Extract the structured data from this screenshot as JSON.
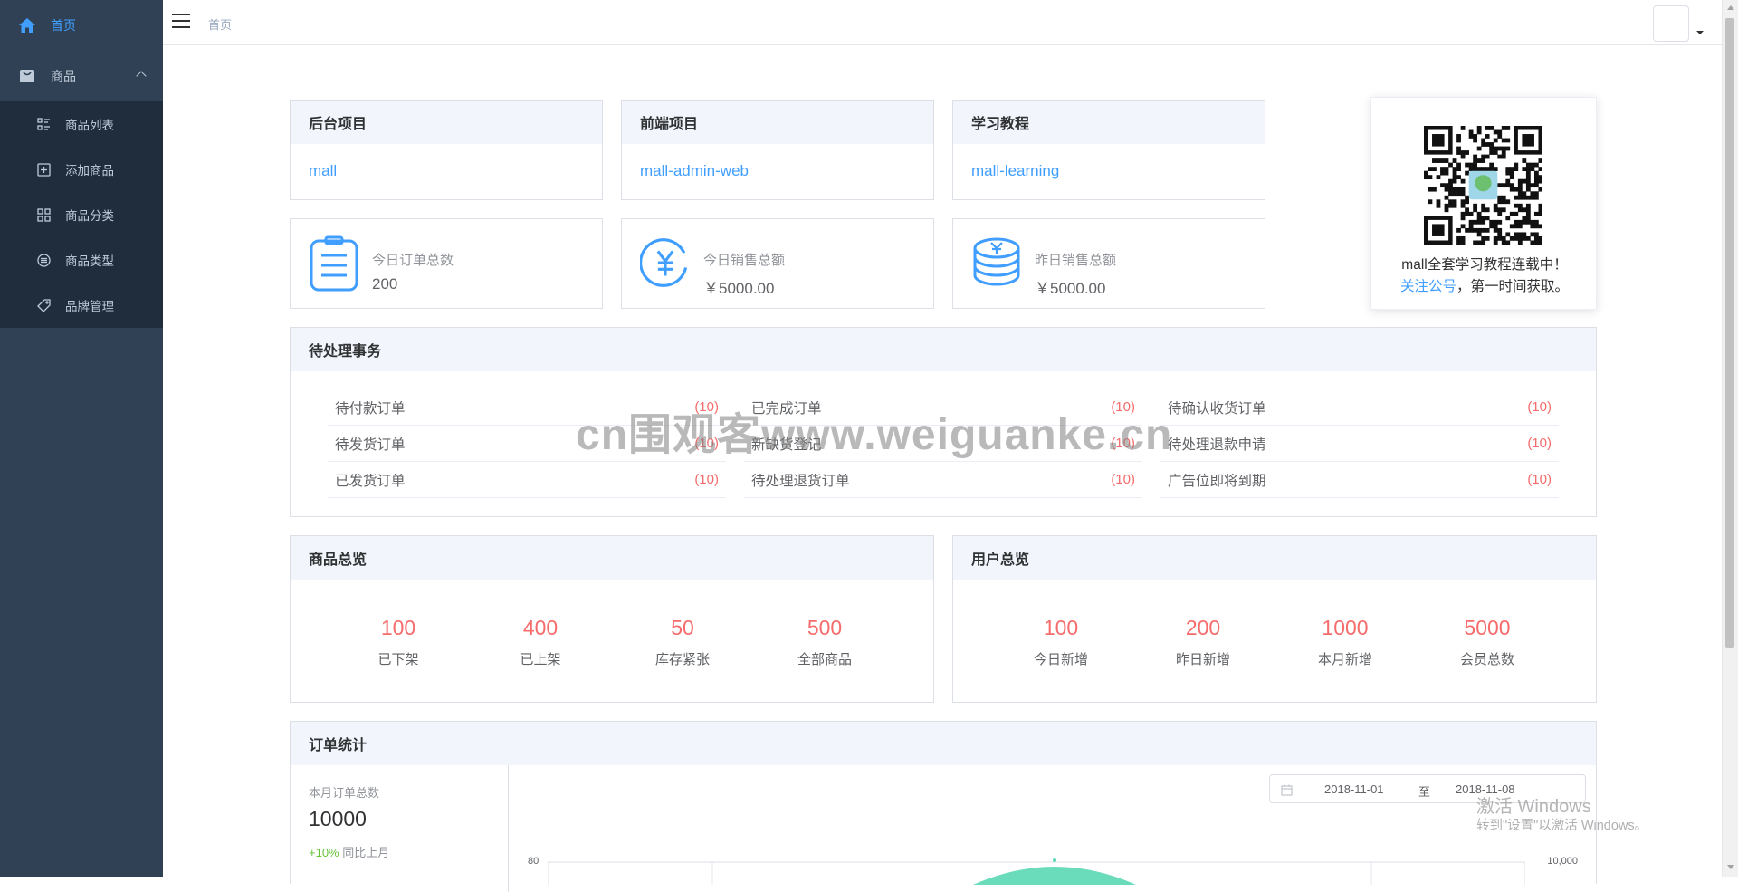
{
  "sidebar": {
    "home": {
      "label": "首页",
      "icon": "home-icon"
    },
    "goods": {
      "label": "商品",
      "icon": "bag-icon"
    },
    "items": [
      {
        "label": "商品列表",
        "icon": "list-icon"
      },
      {
        "label": "添加商品",
        "icon": "add-box-icon"
      },
      {
        "label": "商品分类",
        "icon": "grid-icon"
      },
      {
        "label": "商品类型",
        "icon": "type-icon"
      },
      {
        "label": "品牌管理",
        "icon": "tag-icon"
      }
    ]
  },
  "navbar": {
    "breadcrumb": "首页"
  },
  "projects": [
    {
      "title": "后台项目",
      "link": "mall"
    },
    {
      "title": "前端项目",
      "link": "mall-admin-web"
    },
    {
      "title": "学习教程",
      "link": "mall-learning"
    }
  ],
  "stats": [
    {
      "label": "今日订单总数",
      "value": "200",
      "icon": "order-icon"
    },
    {
      "label": "今日销售总额",
      "value": "￥5000.00",
      "icon": "yen-circle-icon"
    },
    {
      "label": "昨日销售总额",
      "value": "￥5000.00",
      "icon": "coins-icon"
    }
  ],
  "qr": {
    "line1": "mall全套学习教程连载中！",
    "link": "关注公号",
    "line2_rest": "，第一时间获取。"
  },
  "todo": {
    "title": "待处理事务",
    "rows": [
      {
        "label": "待付款订单",
        "count": "(10)"
      },
      {
        "label": "已完成订单",
        "count": "(10)"
      },
      {
        "label": "待确认收货订单",
        "count": "(10)"
      },
      {
        "label": "待发货订单",
        "count": "(10)"
      },
      {
        "label": "新缺货登记",
        "count": "(10)"
      },
      {
        "label": "待处理退款申请",
        "count": "(10)"
      },
      {
        "label": "已发货订单",
        "count": "(10)"
      },
      {
        "label": "待处理退货订单",
        "count": "(10)"
      },
      {
        "label": "广告位即将到期",
        "count": "(10)"
      }
    ]
  },
  "goods_overview": {
    "title": "商品总览",
    "items": [
      {
        "value": "100",
        "label": "已下架"
      },
      {
        "value": "400",
        "label": "已上架"
      },
      {
        "value": "50",
        "label": "库存紧张"
      },
      {
        "value": "500",
        "label": "全部商品"
      }
    ]
  },
  "user_overview": {
    "title": "用户总览",
    "items": [
      {
        "value": "100",
        "label": "今日新增"
      },
      {
        "value": "200",
        "label": "昨日新增"
      },
      {
        "value": "1000",
        "label": "本月新增"
      },
      {
        "value": "5000",
        "label": "会员总数"
      }
    ]
  },
  "order_stats": {
    "title": "订单统计",
    "month_label": "本月订单总数",
    "month_value": "10000",
    "change": "+10%",
    "change_label": "同比上月",
    "date_from": "2018-11-01",
    "date_sep": "至",
    "date_to": "2018-11-08",
    "axis_left_top": "80",
    "axis_right_top": "10,000"
  },
  "overlay": {
    "watermark": "cn围观客www.weiguanke.cn",
    "win_title": "激活 Windows",
    "win_sub": "转到\"设置\"以激活 Windows。"
  },
  "colors": {
    "sidebar": "#304156",
    "submenu": "#1f2d3d",
    "accent": "#409eff",
    "danger": "#f56c6c",
    "success": "#67c23a",
    "chart": "#5ad8b5"
  }
}
